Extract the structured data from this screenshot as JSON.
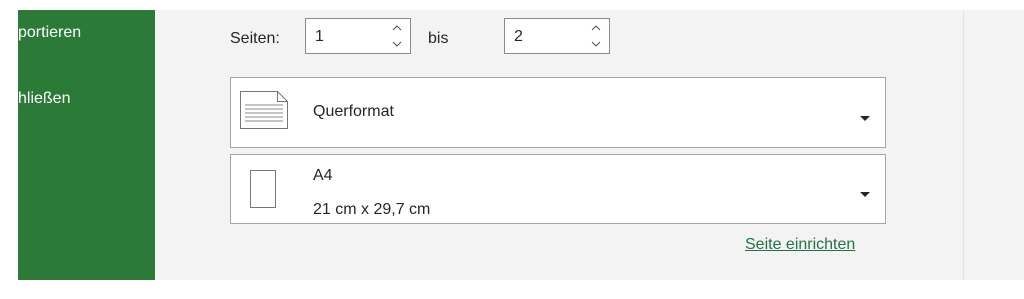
{
  "sidebar": {
    "items": [
      {
        "label": "portieren"
      },
      {
        "label": "hließen"
      }
    ]
  },
  "pages": {
    "label": "Seiten:",
    "from_value": "1",
    "to_label": "bis",
    "to_value": "2"
  },
  "orientation": {
    "label": "Querformat"
  },
  "paper_size": {
    "name": "A4",
    "dimensions": "21 cm x 29,7 cm"
  },
  "links": {
    "page_setup": "Seite einrichten"
  },
  "colors": {
    "sidebar": "#2b7a37",
    "background": "#f3f3f3",
    "link": "#217346"
  }
}
